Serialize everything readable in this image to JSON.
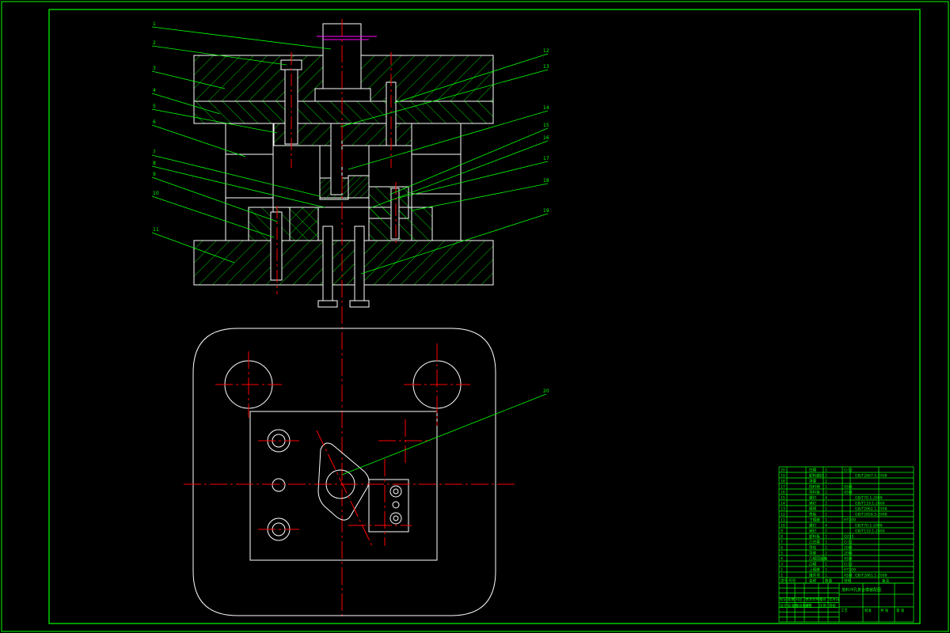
{
  "colors": {
    "background": "#000000",
    "frame": "#00ff00",
    "leader": "#00ff00",
    "hatch": "#00ff00",
    "outline": "#ffffff",
    "center_line": "#ff0000",
    "dimension": "#ff00ff",
    "table_text": "#00ff00"
  },
  "section_view": {
    "part_callouts_left": [
      "1",
      "2",
      "3",
      "4",
      "5",
      "6",
      "7",
      "8",
      "9",
      "10",
      "11"
    ],
    "part_callouts_right": [
      "12",
      "13",
      "14",
      "15",
      "16",
      "17",
      "18",
      "19"
    ]
  },
  "plan_view": {
    "part_callouts": [
      "20"
    ]
  },
  "bom": {
    "rows": [
      {
        "no": "20",
        "code": "",
        "name": "凹模",
        "qty": "1",
        "material": "Cr12",
        "standard": "",
        "remark": ""
      },
      {
        "no": "19",
        "code": "",
        "name": "卸料螺钉",
        "qty": "2",
        "material": "",
        "standard": "GB/T2867.5-2008",
        "remark": ""
      },
      {
        "no": "18",
        "code": "",
        "name": "弹簧",
        "qty": "2",
        "material": "",
        "standard": "",
        "remark": ""
      },
      {
        "no": "17",
        "code": "",
        "name": "挡料销",
        "qty": "1",
        "material": "45钢",
        "standard": "",
        "remark": ""
      },
      {
        "no": "16",
        "code": "",
        "name": "导料板",
        "qty": "2",
        "material": "45钢",
        "standard": "",
        "remark": ""
      },
      {
        "no": "15",
        "code": "",
        "name": "螺钉",
        "qty": "4",
        "material": "",
        "standard": "GB/T70.1-2008",
        "remark": ""
      },
      {
        "no": "14",
        "code": "",
        "name": "销钉",
        "qty": "2",
        "material": "",
        "standard": "GB/T119.1-2000",
        "remark": ""
      },
      {
        "no": "13",
        "code": "",
        "name": "模柄",
        "qty": "1",
        "material": "",
        "standard": "GB/T2862.1-2008",
        "remark": ""
      },
      {
        "no": "12",
        "code": "",
        "name": "垫板",
        "qty": "1",
        "material": "",
        "standard": "GB/T2858.5-2008",
        "remark": ""
      },
      {
        "no": "11",
        "code": "",
        "name": "下模座",
        "qty": "1",
        "material": "HT200",
        "standard": "",
        "remark": ""
      },
      {
        "no": "10",
        "code": "",
        "name": "螺钉",
        "qty": "4",
        "material": "",
        "standard": "GB/T70.1-2008",
        "remark": ""
      },
      {
        "no": "9",
        "code": "",
        "name": "销钉",
        "qty": "2",
        "material": "",
        "standard": "GB/T119.1-2000",
        "remark": ""
      },
      {
        "no": "8",
        "code": "",
        "name": "卸料板",
        "qty": "1",
        "material": "Q235",
        "standard": "",
        "remark": ""
      },
      {
        "no": "7",
        "code": "",
        "name": "凸凹模",
        "qty": "1",
        "material": "Cr12",
        "standard": "",
        "remark": ""
      },
      {
        "no": "6",
        "code": "",
        "name": "导柱",
        "qty": "2",
        "material": "20钢",
        "standard": "",
        "remark": ""
      },
      {
        "no": "5",
        "code": "",
        "name": "导套",
        "qty": "2",
        "material": "20钢",
        "standard": "",
        "remark": ""
      },
      {
        "no": "4",
        "code": "",
        "name": "凸模固定板",
        "qty": "1",
        "material": "45钢",
        "standard": "",
        "remark": ""
      },
      {
        "no": "3",
        "code": "",
        "name": "凸模",
        "qty": "1",
        "material": "Cr12",
        "standard": "",
        "remark": ""
      },
      {
        "no": "2",
        "code": "",
        "name": "上模座",
        "qty": "1",
        "material": "HT200",
        "standard": "",
        "remark": ""
      },
      {
        "no": "1",
        "code": "",
        "name": "推件块",
        "qty": "1",
        "material": "45钢",
        "standard": "GB/T2861.1-2008",
        "remark": ""
      }
    ],
    "header": {
      "no": "序号",
      "code": "代号",
      "name": "名称",
      "qty": "数量",
      "material": "材料",
      "standard": "",
      "remark": "备注"
    }
  },
  "title_block": {
    "drawing_title": "落料冲孔复合模装配图",
    "labels": [
      "标记",
      "处数",
      "分区",
      "更改文件号",
      "签名",
      "年月日",
      "设计",
      "标准化",
      "阶段标记",
      "重量",
      "比例",
      "审核",
      "工艺",
      "批准",
      "共 张",
      "第 张"
    ]
  }
}
